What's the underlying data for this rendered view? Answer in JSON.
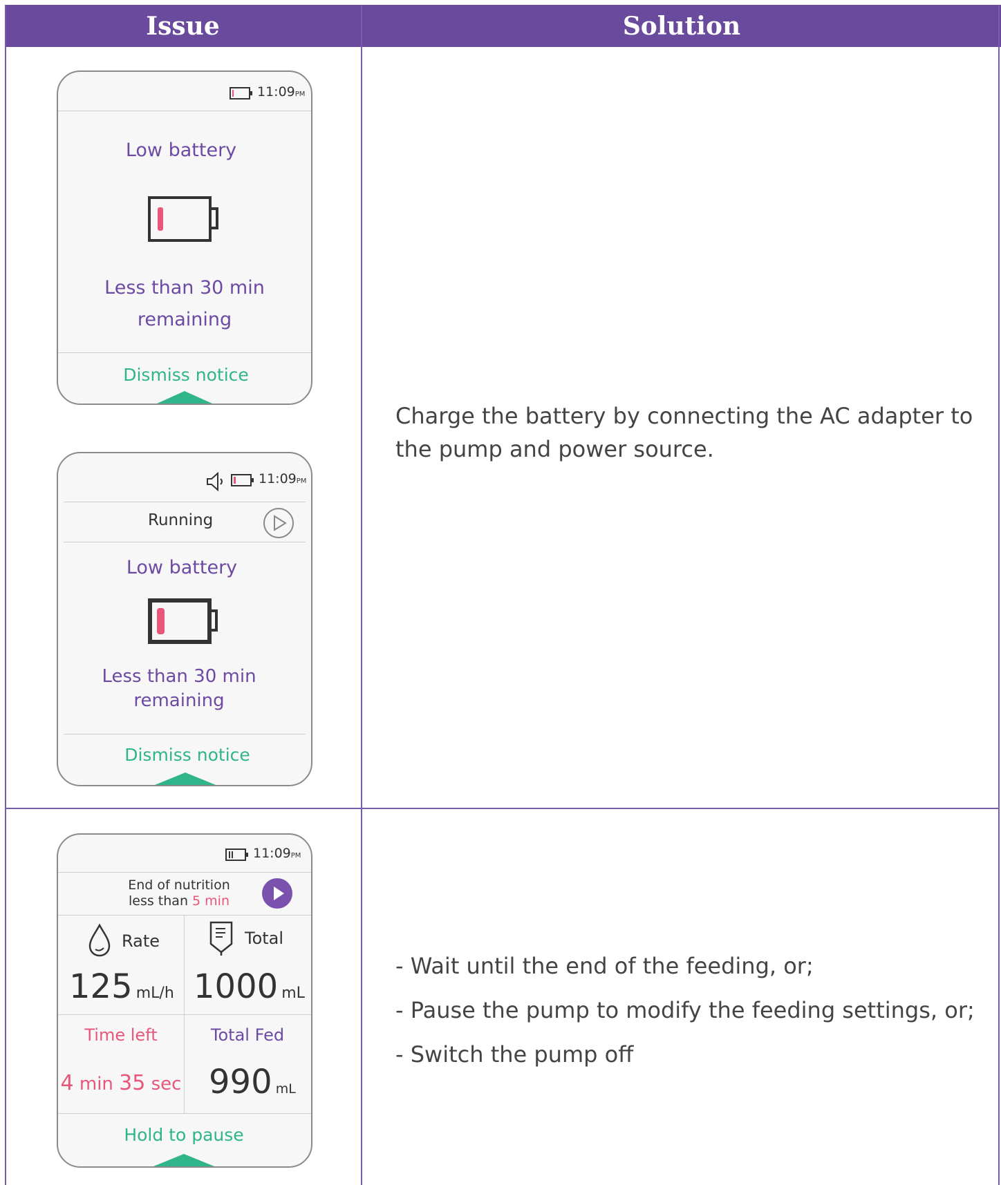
{
  "table": {
    "header_issue": "Issue",
    "header_solution": "Solution"
  },
  "row1": {
    "screen_a": {
      "time": "11:09",
      "time_suffix": "PM",
      "title": "Low battery",
      "message_line1": "Less than 30 min",
      "message_line2": "remaining",
      "action": "Dismiss notice"
    },
    "screen_b": {
      "time": "11:09",
      "time_suffix": "PM",
      "status": "Running",
      "title": "Low battery",
      "message_line1": "Less than 30 min",
      "message_line2": "remaining",
      "action": "Dismiss notice"
    },
    "solution_line1": "Charge the battery by connecting the AC adapter to",
    "solution_line2": "the pump and power source."
  },
  "row2": {
    "screen": {
      "time": "11:09",
      "time_suffix": "PM",
      "status_line1": "End of nutrition",
      "status_line2_prefix": "less than",
      "status_line2_value": "5 min",
      "rate_label": "Rate",
      "rate_value": "125",
      "rate_unit": "mL/h",
      "total_label": "Total",
      "total_value": "1000",
      "total_unit": "mL",
      "time_left_label": "Time left",
      "time_left_min_value": "4",
      "time_left_min_unit": "min",
      "time_left_sec_value": "35",
      "time_left_sec_unit": "sec",
      "total_fed_label": "Total Fed",
      "total_fed_value": "990",
      "total_fed_unit": "mL",
      "action": "Hold to pause"
    },
    "solution_items": [
      "- Wait until the end of the feeding, or;",
      "- Pause the pump to modify the feeding settings, or;",
      "- Switch the pump off"
    ]
  },
  "colors": {
    "header_bg": "#6a4a9c",
    "accent_purple": "#6c4aa3",
    "accent_green": "#2fb589",
    "alert_pink": "#e8577a"
  }
}
